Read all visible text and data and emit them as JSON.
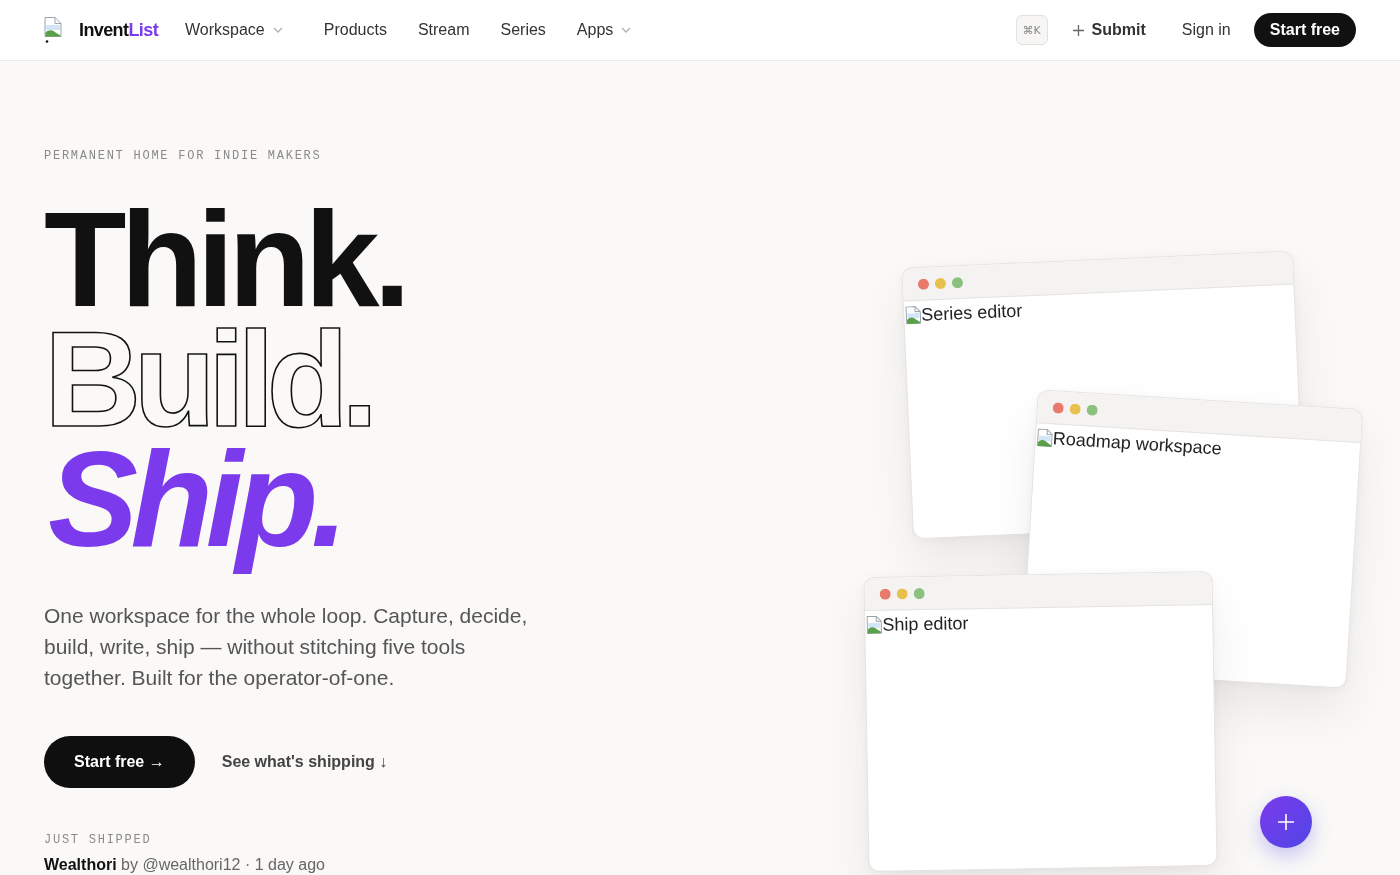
{
  "header": {
    "brand": [
      {
        "text": "Invent",
        "accent": false
      },
      {
        "text": "List",
        "accent": true
      }
    ],
    "nav": [
      {
        "label": "Workspace",
        "dropdown": true
      },
      {
        "label": "Products",
        "dropdown": false
      },
      {
        "label": "Stream",
        "dropdown": false
      },
      {
        "label": "Series",
        "dropdown": false
      },
      {
        "label": "Apps",
        "dropdown": true
      }
    ],
    "shortcut": "⌘K",
    "submit": "Submit",
    "sign_in": "Sign in",
    "cta": "Start free"
  },
  "hero": {
    "eyebrow": "PERMANENT HOME FOR INDIE MAKERS",
    "headline": [
      {
        "text": "Think.",
        "kind": "solid"
      },
      {
        "text": "Build.",
        "kind": "outline"
      },
      {
        "text": "Ship.",
        "kind": "accent"
      }
    ],
    "description": "One workspace for the whole loop. Capture, decide, build, write, ship — without stitching five tools together. Built for the operator-of-one.",
    "primary_button": "Start free →",
    "secondary_link": "See what's shipping ↓",
    "just_shipped": {
      "heading": "JUST SHIPPED",
      "item": "**Wealthori** by @wealthori12 · 1 day ago"
    }
  },
  "showcase": {
    "windows": [
      {
        "image_alt": "Series editor"
      },
      {
        "image_alt": "Roadmap workspace"
      },
      {
        "image_alt": "Ship editor"
      }
    ]
  }
}
